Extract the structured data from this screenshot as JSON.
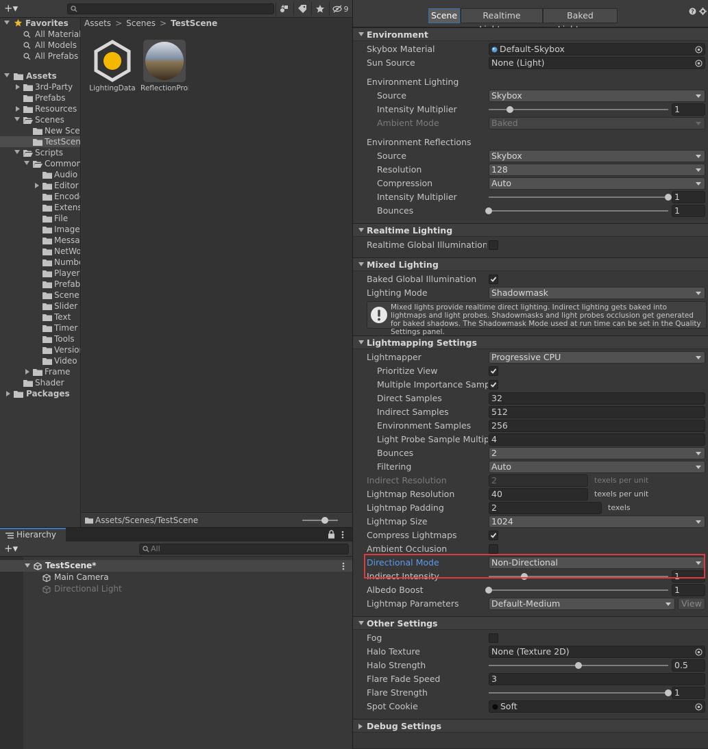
{
  "project": {
    "plus_label": "+▾",
    "hidden_count": "9",
    "tree": [
      {
        "label": "Favorites",
        "bold": true
      },
      {
        "label": "All Materials"
      },
      {
        "label": "All Models"
      },
      {
        "label": "All Prefabs"
      },
      {
        "label": "Assets",
        "bold": true
      },
      {
        "label": "3rd-Party"
      },
      {
        "label": "Prefabs"
      },
      {
        "label": "Resources"
      },
      {
        "label": "Scenes"
      },
      {
        "label": "New Scene"
      },
      {
        "label": "TestScene"
      },
      {
        "label": "Scripts"
      },
      {
        "label": "Common"
      },
      {
        "label": "Audio"
      },
      {
        "label": "Editor"
      },
      {
        "label": "Encoder"
      },
      {
        "label": "Extensions"
      },
      {
        "label": "File"
      },
      {
        "label": "Image"
      },
      {
        "label": "Message"
      },
      {
        "label": "NetWork"
      },
      {
        "label": "Number"
      },
      {
        "label": "Player"
      },
      {
        "label": "Prefab"
      },
      {
        "label": "Scene"
      },
      {
        "label": "Slider"
      },
      {
        "label": "Text"
      },
      {
        "label": "Timer"
      },
      {
        "label": "Tools"
      },
      {
        "label": "Version"
      },
      {
        "label": "Video"
      },
      {
        "label": "Frame"
      },
      {
        "label": "Shader"
      },
      {
        "label": "Packages",
        "bold": true
      }
    ],
    "breadcrumb": [
      "Assets",
      "Scenes",
      "TestScene"
    ],
    "assets": [
      {
        "name": "LightingData"
      },
      {
        "name": "ReflectionProbe"
      }
    ],
    "footer_path": "Assets/Scenes/TestScene"
  },
  "hierarchy": {
    "tab_label": "Hierarchy",
    "search_placeholder": "All",
    "scene_name": "TestScene*",
    "items": [
      "Main Camera",
      "Directional Light"
    ]
  },
  "lighting": {
    "tabs": [
      "Scene",
      "Realtime Lightmaps",
      "Baked Lightmaps"
    ],
    "sections": {
      "environment": "Environment",
      "realtime": "Realtime Lighting",
      "mixed": "Mixed Lighting",
      "lightmapping": "Lightmapping Settings",
      "other": "Other Settings",
      "debug": "Debug Settings"
    },
    "env": {
      "skybox_material_label": "Skybox Material",
      "skybox_material_value": "Default-Skybox",
      "sun_source_label": "Sun Source",
      "sun_source_value": "None (Light)",
      "env_lighting_label": "Environment Lighting",
      "source_label": "Source",
      "source_value": "Skybox",
      "intensity_label": "Intensity Multiplier",
      "intensity_value": "1",
      "intensity_level": 0.12,
      "ambient_mode_label": "Ambient Mode",
      "ambient_mode_value": "Baked",
      "env_reflections_label": "Environment Reflections",
      "refl_source_label": "Source",
      "refl_source_value": "Skybox",
      "resolution_label": "Resolution",
      "resolution_value": "128",
      "compression_label": "Compression",
      "compression_value": "Auto",
      "refl_intensity_label": "Intensity Multiplier",
      "refl_intensity_value": "1",
      "refl_intensity_level": 1.0,
      "bounces_label": "Bounces",
      "bounces_value": "1",
      "bounces_level": 0.0
    },
    "realtime": {
      "rtgi_label": "Realtime Global Illumination (Deprecated)"
    },
    "mixed": {
      "bakedgi_label": "Baked Global Illumination",
      "lighting_mode_label": "Lighting Mode",
      "lighting_mode_value": "Shadowmask",
      "help_text": "Mixed lights provide realtime direct lighting. Indirect lighting gets baked into lightmaps and light probes. Shadowmasks and light probes occlusion get generated for baked shadows. The Shadowmask Mode used at run time can be set in the Quality Settings panel."
    },
    "lightmapping": {
      "lightmapper_label": "Lightmapper",
      "lightmapper_value": "Progressive CPU",
      "prioritize_label": "Prioritize View",
      "mis_label": "Multiple Importance Sampling",
      "direct_label": "Direct Samples",
      "direct_value": "32",
      "indirect_label": "Indirect Samples",
      "indirect_value": "512",
      "env_samples_label": "Environment Samples",
      "env_samples_value": "256",
      "lpsm_label": "Light Probe Sample Multiplier",
      "lpsm_value": "4",
      "bounces_label": "Bounces",
      "bounces_value": "2",
      "filtering_label": "Filtering",
      "filtering_value": "Auto",
      "indirect_res_label": "Indirect Resolution",
      "indirect_res_value": "2",
      "texels_per_unit": "texels per unit",
      "lm_res_label": "Lightmap Resolution",
      "lm_res_value": "40",
      "lm_res_unit": "texels per unit",
      "lm_padding_label": "Lightmap Padding",
      "lm_padding_value": "2",
      "texels": "texels",
      "lm_size_label": "Lightmap Size",
      "lm_size_value": "1024",
      "compress_label": "Compress Lightmaps",
      "ao_label": "Ambient Occlusion",
      "dir_mode_label": "Directional Mode",
      "dir_mode_value": "Non-Directional",
      "indirect_intensity_label": "Indirect Intensity",
      "indirect_intensity_value": "1",
      "indirect_intensity_level": 0.2,
      "albedo_label": "Albedo Boost",
      "albedo_value": "1",
      "albedo_level": 0.0,
      "lm_params_label": "Lightmap Parameters",
      "lm_params_value": "Default-Medium",
      "view_label": "View"
    },
    "other": {
      "fog_label": "Fog",
      "halo_texture_label": "Halo Texture",
      "halo_texture_value": "None (Texture 2D)",
      "halo_strength_label": "Halo Strength",
      "halo_strength_value": "0.5",
      "halo_strength_level": 0.5,
      "flare_fade_label": "Flare Fade Speed",
      "flare_fade_value": "3",
      "flare_strength_label": "Flare Strength",
      "flare_strength_value": "1",
      "flare_strength_level": 1.0,
      "spot_cookie_label": "Spot Cookie",
      "spot_cookie_value": "Soft"
    }
  },
  "colors": {
    "accent": "#3a79bb",
    "highlight": "#e03a3a",
    "link_label": "#5a9ae8"
  }
}
